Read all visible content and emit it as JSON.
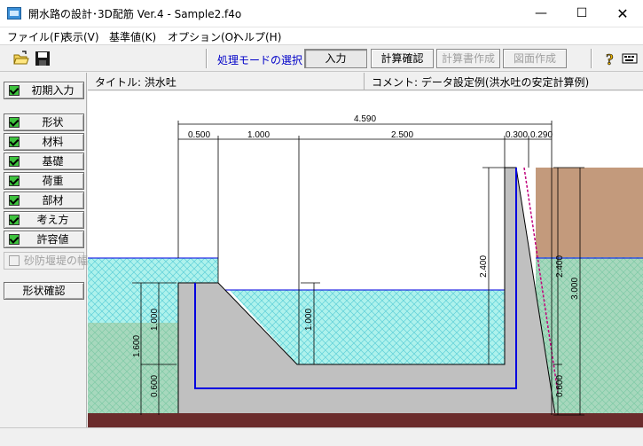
{
  "window": {
    "title": "開水路の設計･3D配筋 Ver.4 - Sample2.f4o",
    "minimize": "—",
    "maximize": "☐",
    "close": "✕"
  },
  "menu": [
    {
      "id": "file",
      "label": "ファイル(F)"
    },
    {
      "id": "view",
      "label": "表示(V)"
    },
    {
      "id": "standard",
      "label": "基準値(K)"
    },
    {
      "id": "options",
      "label": "オプション(O)"
    },
    {
      "id": "help",
      "label": "ヘルプ(H)"
    }
  ],
  "toolbar": {
    "mode_label": "処理モードの選択",
    "modes": [
      {
        "id": "input",
        "label": "入力",
        "state": "active"
      },
      {
        "id": "calc-check",
        "label": "計算確認",
        "state": "enabled"
      },
      {
        "id": "report",
        "label": "計算書作成",
        "state": "disabled"
      },
      {
        "id": "drawing",
        "label": "図面作成",
        "state": "disabled"
      }
    ],
    "icons": [
      "open-folder-icon",
      "save-icon",
      "help-icon",
      "keyboard-icon"
    ]
  },
  "sidebar": {
    "initial": "初期入力",
    "items": [
      {
        "id": "shape",
        "label": "形状"
      },
      {
        "id": "material",
        "label": "材料"
      },
      {
        "id": "foundation",
        "label": "基礎"
      },
      {
        "id": "load",
        "label": "荷重"
      },
      {
        "id": "member",
        "label": "部材"
      },
      {
        "id": "approach",
        "label": "考え方"
      },
      {
        "id": "allowable",
        "label": "許容値"
      }
    ],
    "disabled_item": "砂防堰堤の幅",
    "shape_confirm": "形状確認"
  },
  "info": {
    "title": "タイトル: 洪水吐",
    "comment": "コメント: データ設定例(洪水吐の安定計算例)"
  },
  "drawing": {
    "dims_top": {
      "total": "4.590",
      "seg1": "0.500",
      "seg2": "1.000",
      "seg3": "2.500",
      "seg4": "0.300",
      "seg5": "0.290"
    },
    "dims_vertical": {
      "inner_height": "2.400",
      "right_height": "2.400",
      "right_total": "3.000",
      "left_total": "1.600",
      "left_upper": "1.000",
      "left_lower": "0.600",
      "slope_height": "1.000",
      "right_lower": "0.600"
    },
    "colors": {
      "concrete": "#c0c0c0",
      "water": "#aef2ec",
      "water_hatch": "#5fd0d8",
      "soil": "#c39a7c",
      "soil_hatch": "#a0d4b6",
      "ground": "#6b2c2c",
      "rebar": "#0000e0"
    }
  }
}
